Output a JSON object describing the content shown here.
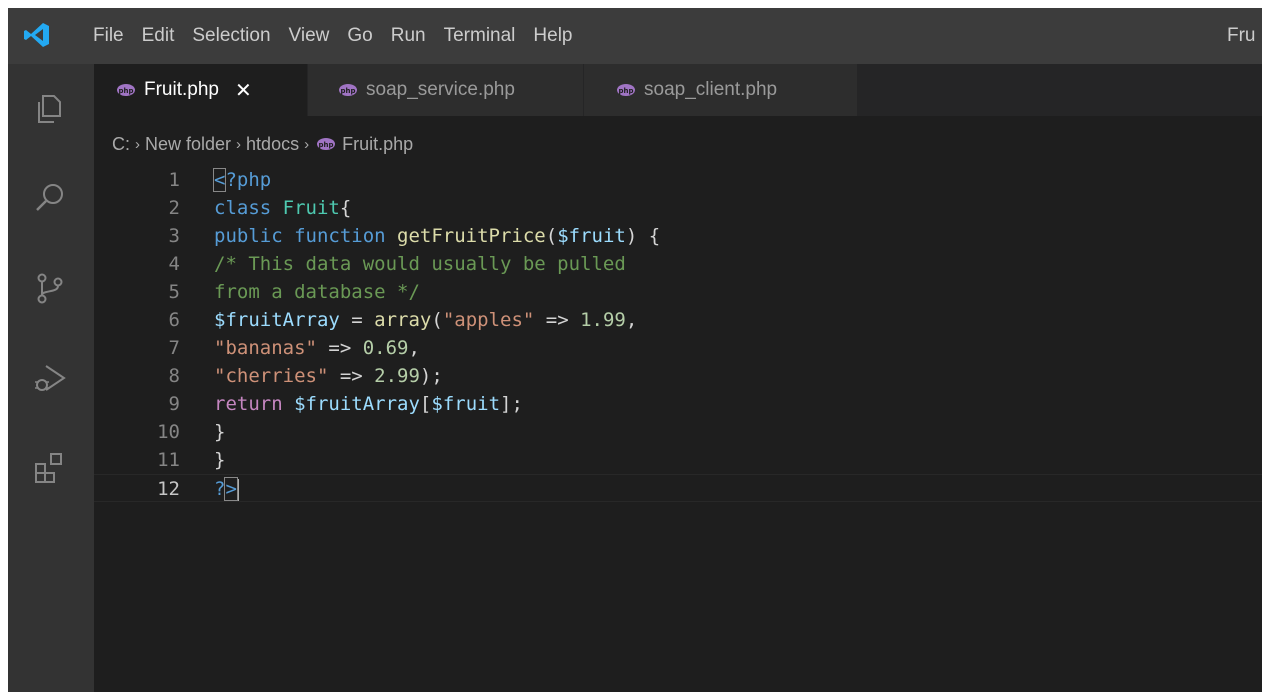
{
  "menu": {
    "items": [
      "File",
      "Edit",
      "Selection",
      "View",
      "Go",
      "Run",
      "Terminal",
      "Help"
    ],
    "window_title": "Fru"
  },
  "activity_bar": {
    "icons": [
      "explorer-icon",
      "search-icon",
      "source-control-icon",
      "run-debug-icon",
      "extensions-icon"
    ]
  },
  "tabs": [
    {
      "label": "Fruit.php",
      "active": true,
      "close": "✕"
    },
    {
      "label": "soap_service.php",
      "active": false
    },
    {
      "label": "soap_client.php",
      "active": false
    }
  ],
  "breadcrumb": {
    "parts": [
      "C:",
      "New folder",
      "htdocs",
      "Fruit.php"
    ],
    "separator": "›"
  },
  "editor": {
    "current_line": 12,
    "lines": [
      {
        "n": "1",
        "tokens": [
          {
            "t": "<",
            "c": "tok-kw br"
          },
          {
            "t": "?php",
            "c": "tok-kw"
          }
        ]
      },
      {
        "n": "2",
        "tokens": [
          {
            "t": "class ",
            "c": "tok-kw"
          },
          {
            "t": "Fruit",
            "c": "tok-cls"
          },
          {
            "t": "{",
            "c": "tok-punc"
          }
        ]
      },
      {
        "n": "3",
        "tokens": [
          {
            "t": "public ",
            "c": "tok-kw"
          },
          {
            "t": "function ",
            "c": "tok-kw"
          },
          {
            "t": "getFruitPrice",
            "c": "tok-fn"
          },
          {
            "t": "(",
            "c": "tok-punc"
          },
          {
            "t": "$fruit",
            "c": "tok-var"
          },
          {
            "t": ") {",
            "c": "tok-punc"
          }
        ]
      },
      {
        "n": "4",
        "tokens": [
          {
            "t": "/* This data would usually be pulled",
            "c": "tok-cmt"
          }
        ]
      },
      {
        "n": "5",
        "tokens": [
          {
            "t": "from a database */",
            "c": "tok-cmt"
          }
        ]
      },
      {
        "n": "6",
        "tokens": [
          {
            "t": "$fruitArray",
            "c": "tok-var"
          },
          {
            "t": " = ",
            "c": "tok-punc"
          },
          {
            "t": "array",
            "c": "tok-fn"
          },
          {
            "t": "(",
            "c": "tok-punc"
          },
          {
            "t": "\"apples\"",
            "c": "tok-str"
          },
          {
            "t": " => ",
            "c": "tok-punc"
          },
          {
            "t": "1.99",
            "c": "tok-num"
          },
          {
            "t": ",",
            "c": "tok-punc"
          }
        ]
      },
      {
        "n": "7",
        "tokens": [
          {
            "t": "\"bananas\"",
            "c": "tok-str"
          },
          {
            "t": " => ",
            "c": "tok-punc"
          },
          {
            "t": "0.69",
            "c": "tok-num"
          },
          {
            "t": ",",
            "c": "tok-punc"
          }
        ]
      },
      {
        "n": "8",
        "tokens": [
          {
            "t": "\"cherries\"",
            "c": "tok-str"
          },
          {
            "t": " => ",
            "c": "tok-punc"
          },
          {
            "t": "2.99",
            "c": "tok-num"
          },
          {
            "t": ");",
            "c": "tok-punc"
          }
        ]
      },
      {
        "n": "9",
        "tokens": [
          {
            "t": "return ",
            "c": "tok-ctrl"
          },
          {
            "t": "$fruitArray",
            "c": "tok-var"
          },
          {
            "t": "[",
            "c": "tok-punc"
          },
          {
            "t": "$fruit",
            "c": "tok-var"
          },
          {
            "t": "];",
            "c": "tok-punc"
          }
        ]
      },
      {
        "n": "10",
        "tokens": [
          {
            "t": "}",
            "c": "tok-punc"
          }
        ]
      },
      {
        "n": "11",
        "tokens": [
          {
            "t": "}",
            "c": "tok-punc"
          }
        ]
      },
      {
        "n": "12",
        "tokens": [
          {
            "t": "?",
            "c": "tok-kw"
          },
          {
            "t": ">",
            "c": "tok-kw br"
          }
        ]
      }
    ]
  },
  "colors": {
    "accent_logo": "#23a9f2",
    "php_icon": "#a074c4"
  }
}
